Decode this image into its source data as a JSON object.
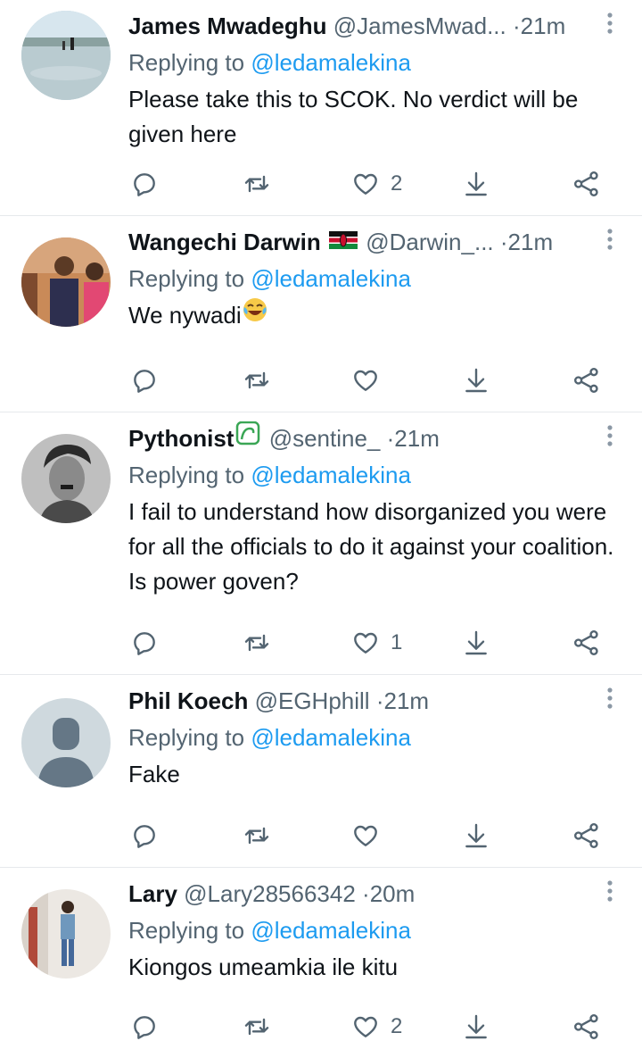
{
  "app": "Twitter replies thread",
  "colors": {
    "accent": "#1d9bf0",
    "muted": "#536471",
    "text": "#0f1419",
    "divider": "#e6e9ec"
  },
  "icons": {
    "reply": "reply-icon",
    "retweet": "retweet-icon",
    "like": "heart-icon",
    "download": "download-icon",
    "share": "share-icon",
    "more": "more-vertical-icon"
  },
  "tweets": [
    {
      "name": "James Mwadeghu",
      "handle": "@JamesMwad...",
      "dot": "·",
      "time": "21m",
      "replying_prefix": "Replying to ",
      "replying_to": "@ledamalekina",
      "text": "Please take this to SCOK. No verdict will be given here",
      "like_count": "2",
      "badge": ""
    },
    {
      "name": "Wangechi Darwin",
      "handle": "@Darwin_...",
      "dot": "·",
      "time": "21m",
      "replying_prefix": "Replying to ",
      "replying_to": "@ledamalekina",
      "text": "We nywadi",
      "text_emoji": "tears-of-joy-emoji",
      "like_count": "",
      "badge": "kenya-flag-emoji"
    },
    {
      "name": "Pythonist",
      "handle": "@sentine_",
      "dot": "·",
      "time": "21m",
      "replying_prefix": "Replying to ",
      "replying_to": "@ledamalekina",
      "text": "I fail to understand how disorganized you were for all the officials to do it against your coalition. Is power goven?",
      "like_count": "1",
      "badge": "green-snake-badge"
    },
    {
      "name": "Phil Koech",
      "handle": "@EGHphill",
      "dot": "·",
      "time": "21m",
      "replying_prefix": "Replying to ",
      "replying_to": "@ledamalekina",
      "text": "Fake",
      "like_count": "",
      "badge": ""
    },
    {
      "name": "Lary",
      "handle": "@Lary28566342",
      "dot": "·",
      "time": "20m",
      "replying_prefix": "Replying to ",
      "replying_to": "@ledamalekina",
      "text": "Kiongos umeamkia ile kitu",
      "like_count": "2",
      "badge": ""
    }
  ]
}
